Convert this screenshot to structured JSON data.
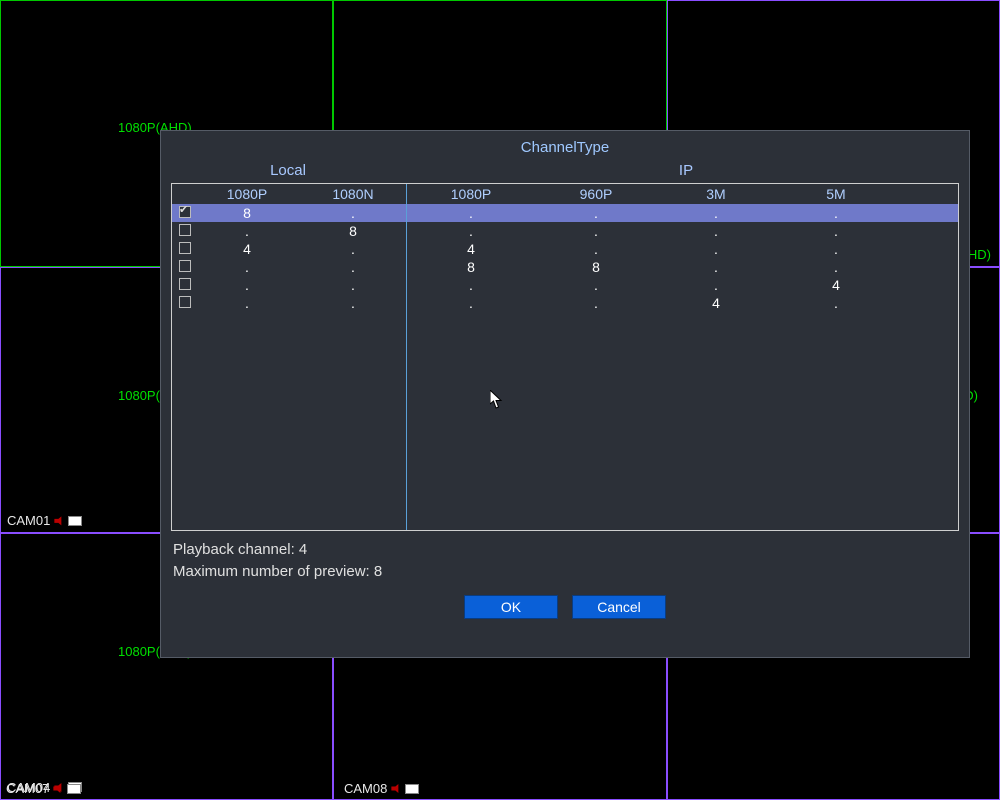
{
  "bg": {
    "cells": [
      {
        "cam": "",
        "res": "",
        "green": true
      },
      {
        "cam": "",
        "res": "",
        "green": true
      },
      {
        "cam": "",
        "res": "",
        "green": false,
        "res_right": "1080P(AHD)"
      },
      {
        "cam": "CAM01",
        "res": "1080P(AHD)",
        "green": false
      },
      {
        "cam": "",
        "res": "",
        "green": false
      },
      {
        "cam": "",
        "res": "1080P(AHD)",
        "green": false
      },
      {
        "cam": "CAM04",
        "res": "1080P(AHD)",
        "green": false
      },
      {
        "cam": "",
        "res": "",
        "green": false
      },
      {
        "cam": "",
        "res": "1080P(AHD)",
        "green": false
      }
    ],
    "bottom_row": [
      {
        "cam": "CAM07",
        "res": ""
      },
      {
        "cam": "CAM08",
        "res": ""
      },
      {
        "cam": "",
        "res": ""
      }
    ],
    "res_left_mid": "1080P(AHD)",
    "res_left_bottom": "1080P(AHD)"
  },
  "dialog": {
    "title": "ChannelType",
    "section_local": "Local",
    "section_ip": "IP",
    "columns": [
      "1080P",
      "1080N",
      "1080P",
      "960P",
      "3M",
      "5M"
    ],
    "rows": [
      {
        "checked": true,
        "vals": [
          "8",
          ".",
          ".",
          ".",
          ".",
          "."
        ]
      },
      {
        "checked": false,
        "vals": [
          ".",
          "8",
          ".",
          ".",
          ".",
          "."
        ]
      },
      {
        "checked": false,
        "vals": [
          "4",
          ".",
          "4",
          ".",
          ".",
          "."
        ]
      },
      {
        "checked": false,
        "vals": [
          ".",
          ".",
          "8",
          "8",
          ".",
          "."
        ]
      },
      {
        "checked": false,
        "vals": [
          ".",
          ".",
          ".",
          ".",
          ".",
          "4"
        ]
      },
      {
        "checked": false,
        "vals": [
          ".",
          ".",
          ".",
          ".",
          "4",
          "."
        ]
      }
    ],
    "info_playback": "Playback channel: 4",
    "info_maxpreview": "Maximum number of preview: 8",
    "ok_label": "OK",
    "cancel_label": "Cancel"
  }
}
